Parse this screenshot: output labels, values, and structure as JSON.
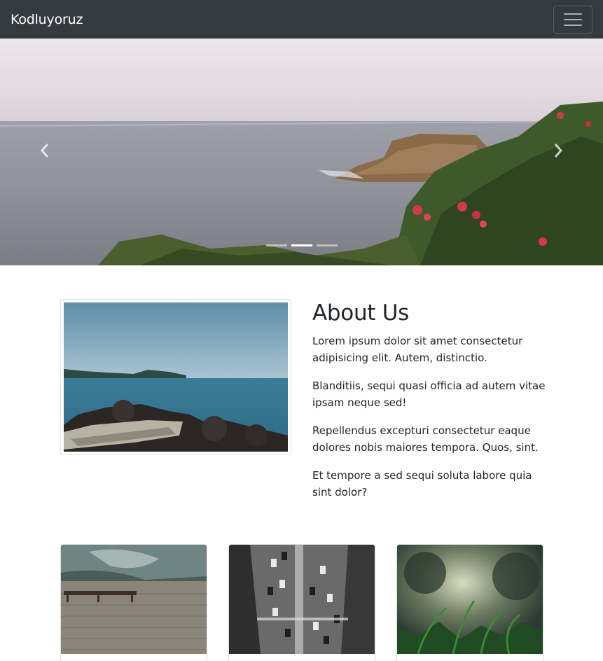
{
  "navbar": {
    "brand": "Kodluyoruz",
    "background": "#343a40",
    "toggler_icon": "hamburger-icon"
  },
  "carousel": {
    "prev_icon": "chevron-left-icon",
    "next_icon": "chevron-right-icon",
    "slide_count": 3,
    "active_slide": 2
  },
  "about": {
    "title": "About Us",
    "paragraphs": [
      "Lorem ipsum dolor sit amet consectetur adipisicing elit. Autem, distinctio.",
      "Blanditiis, sequi quasi officia ad autem vitae ipsam neque sed!",
      "Repellendus excepturi consectetur eaque dolores nobis maiores tempora. Quos, sint.",
      "Et tempore a sed sequi soluta labore quia sint dolor?"
    ]
  },
  "cards": [
    {
      "image": "pier-photo"
    },
    {
      "image": "city-street-photo"
    },
    {
      "image": "grass-photo"
    }
  ]
}
